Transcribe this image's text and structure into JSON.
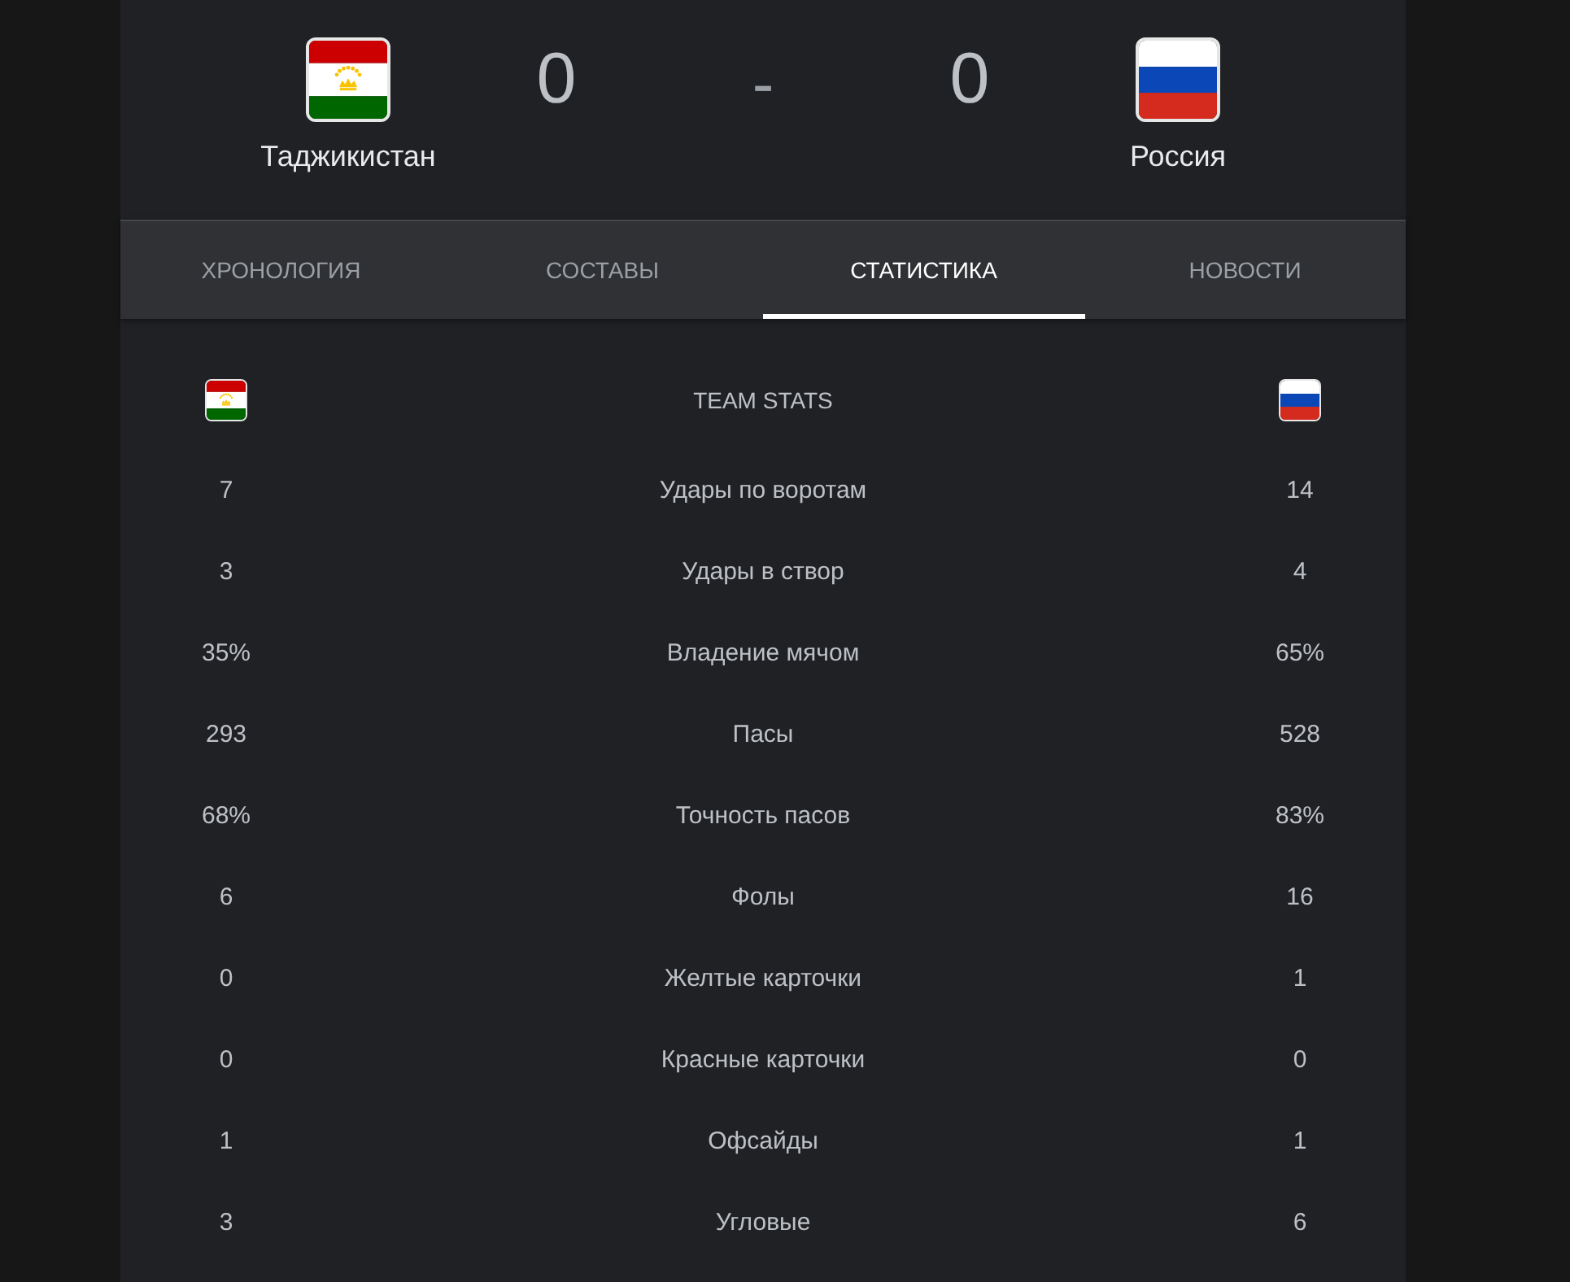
{
  "match": {
    "home": {
      "name": "Таджикистан",
      "score": "0"
    },
    "separator": "-",
    "away": {
      "name": "Россия",
      "score": "0"
    }
  },
  "tabs": [
    {
      "label": "ХРОНОЛОГИЯ",
      "selected": false
    },
    {
      "label": "СОСТАВЫ",
      "selected": false
    },
    {
      "label": "СТАТИСТИКА",
      "selected": true
    },
    {
      "label": "НОВОСТИ",
      "selected": false
    }
  ],
  "team_stats": {
    "title": "TEAM STATS",
    "rows": [
      {
        "label": "Удары по воротам",
        "home": "7",
        "away": "14"
      },
      {
        "label": "Удары в створ",
        "home": "3",
        "away": "4"
      },
      {
        "label": "Владение мячом",
        "home": "35%",
        "away": "65%"
      },
      {
        "label": "Пасы",
        "home": "293",
        "away": "528"
      },
      {
        "label": "Точность пасов",
        "home": "68%",
        "away": "83%"
      },
      {
        "label": "Фолы",
        "home": "6",
        "away": "16"
      },
      {
        "label": "Желтые карточки",
        "home": "0",
        "away": "1"
      },
      {
        "label": "Красные карточки",
        "home": "0",
        "away": "0"
      },
      {
        "label": "Офсайды",
        "home": "1",
        "away": "1"
      },
      {
        "label": "Угловые",
        "home": "3",
        "away": "6"
      }
    ]
  }
}
